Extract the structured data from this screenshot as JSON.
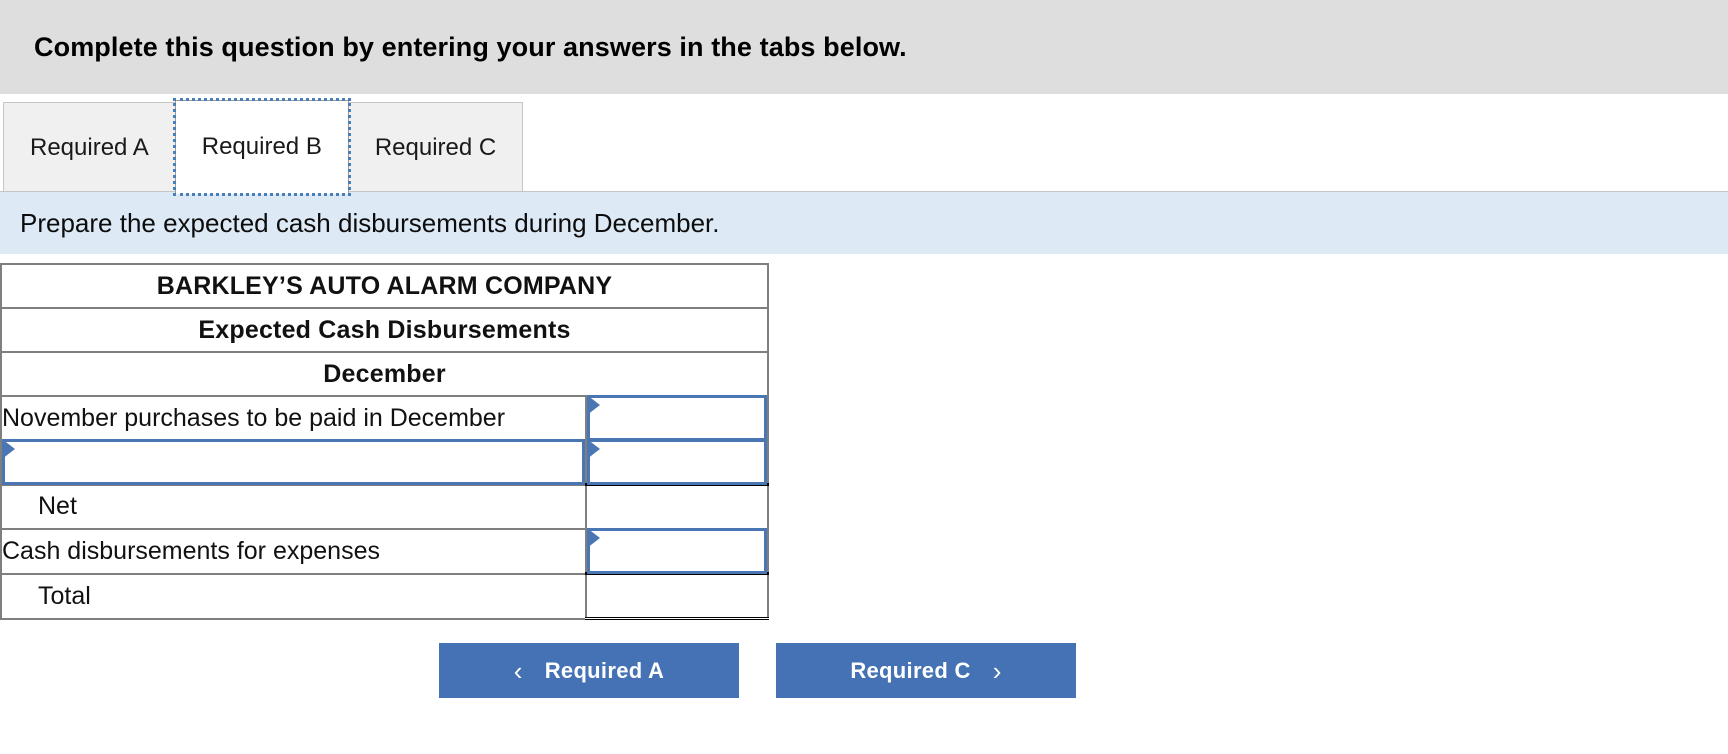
{
  "banner": {
    "instruction": "Complete this question by entering your answers in the tabs below."
  },
  "tabs": [
    {
      "label": "Required A",
      "active": false
    },
    {
      "label": "Required B",
      "active": true
    },
    {
      "label": "Required C",
      "active": false
    }
  ],
  "sub_banner": {
    "text": "Prepare the expected cash disbursements during December."
  },
  "worksheet": {
    "title": "BARKLEY’S AUTO ALARM COMPANY",
    "subtitle": "Expected Cash Disbursements",
    "period": "December",
    "rows": [
      {
        "label": "November purchases to be paid in December",
        "label_editable": false,
        "label_value": "",
        "value": "",
        "value_editable": true,
        "value_rule": "none"
      },
      {
        "label": "",
        "label_editable": true,
        "label_value": "",
        "value": "",
        "value_editable": true,
        "value_rule": "none"
      },
      {
        "label": "Net",
        "label_editable": false,
        "label_value": "",
        "value": "",
        "value_editable": false,
        "value_rule": "top"
      },
      {
        "label": "Cash disbursements for expenses",
        "label_editable": false,
        "label_value": "",
        "value": "",
        "value_editable": true,
        "value_rule": "none"
      },
      {
        "label": "Total",
        "label_editable": false,
        "label_value": "",
        "value": "",
        "value_editable": false,
        "value_rule": "total"
      }
    ]
  },
  "nav": {
    "prev_label": "Required A",
    "next_label": "Required C",
    "prev_icon": "chevron-left-icon",
    "next_icon": "chevron-right-icon",
    "prev_glyph": "‹",
    "next_glyph": "›"
  },
  "colors": {
    "banner_bg": "#dedede",
    "sub_banner_bg": "#ddeaf6",
    "table_header_bg": "#85ace0",
    "input_border": "#4a77b4",
    "button_bg": "#4472b4",
    "grid_border": "#7f7f7f"
  }
}
